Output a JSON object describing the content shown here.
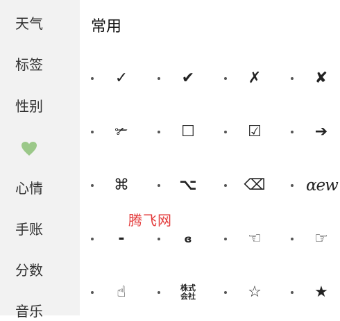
{
  "sidebar": {
    "items": [
      {
        "label": "天气"
      },
      {
        "label": "标签"
      },
      {
        "label": "性别"
      },
      {
        "label": "",
        "icon": "green-heart-icon"
      },
      {
        "label": "心情"
      },
      {
        "label": "手账"
      },
      {
        "label": "分数"
      },
      {
        "label": "音乐"
      }
    ]
  },
  "main": {
    "title": "常用",
    "symbols": [
      [
        "✓",
        "✔",
        "✗",
        "✘"
      ],
      [
        "✃",
        "☐",
        "☑",
        "➔"
      ],
      [
        "⌘",
        "⌥",
        "⌫",
        "ɑew"
      ],
      [
        "-",
        "ɞ",
        "☜",
        "☞"
      ],
      [
        "☝",
        "株式\n会社",
        "☆",
        "★"
      ]
    ]
  },
  "watermark": "腾飞网",
  "colors": {
    "sidebar_bg": "#f2f2f2",
    "watermark": "#e33a3a",
    "heart": "#9bc889"
  }
}
